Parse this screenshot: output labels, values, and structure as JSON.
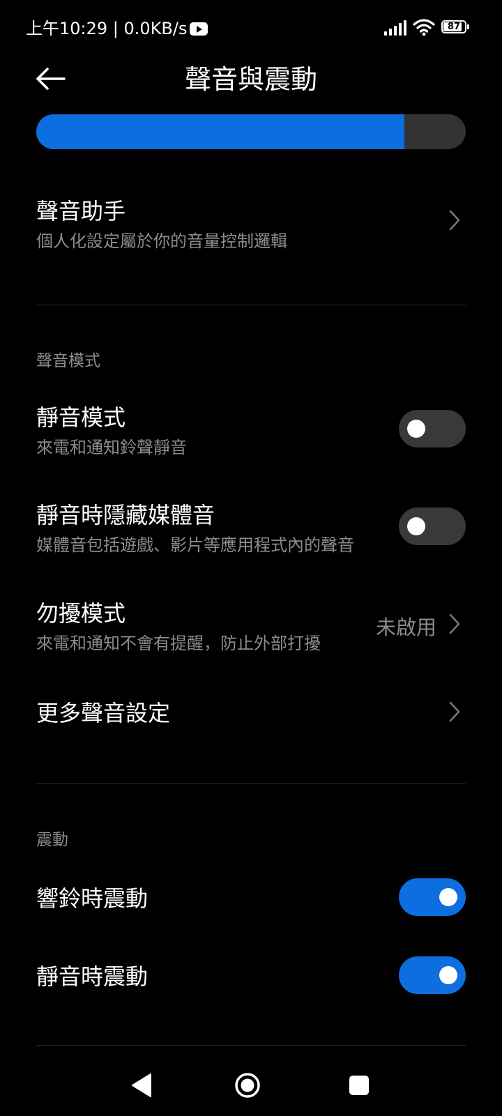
{
  "status_bar": {
    "time_text": "上午10:29 | 0.0KB/s",
    "battery_level": "87",
    "battery_fraction": 0.87,
    "icons": [
      "youtube-icon",
      "signal-icon",
      "wifi-icon",
      "battery-icon"
    ]
  },
  "header": {
    "title": "聲音與震動",
    "back_icon": "arrow-left-icon"
  },
  "volume": {
    "level_fraction": 0.857,
    "fill_color": "#0d6ee0",
    "track_color": "#333333"
  },
  "sound_assistant": {
    "title": "聲音助手",
    "subtitle": "個人化設定屬於你的音量控制邏輯"
  },
  "sound_mode_section": {
    "header": "聲音模式",
    "silent_mode": {
      "title": "靜音模式",
      "subtitle": "來電和通知鈴聲靜音",
      "enabled": false
    },
    "hide_media": {
      "title": "靜音時隱藏媒體音",
      "subtitle": "媒體音包括遊戲、影片等應用程式內的聲音",
      "enabled": false
    },
    "dnd": {
      "title": "勿擾模式",
      "subtitle": "來電和通知不會有提醒，防止外部打擾",
      "value": "未啟用"
    },
    "more_settings": {
      "title": "更多聲音設定"
    }
  },
  "vibration_section": {
    "header": "震動",
    "vibrate_on_ring": {
      "title": "響鈴時震動",
      "enabled": true
    },
    "vibrate_on_silent": {
      "title": "靜音時震動",
      "enabled": true
    }
  },
  "colors": {
    "accent": "#0d6ee0",
    "background": "#000000",
    "secondary_text": "#8c8c8c",
    "toggle_off": "#393939"
  },
  "nav_bar": {
    "icons": [
      "nav-back-icon",
      "nav-home-icon",
      "nav-recents-icon"
    ]
  }
}
